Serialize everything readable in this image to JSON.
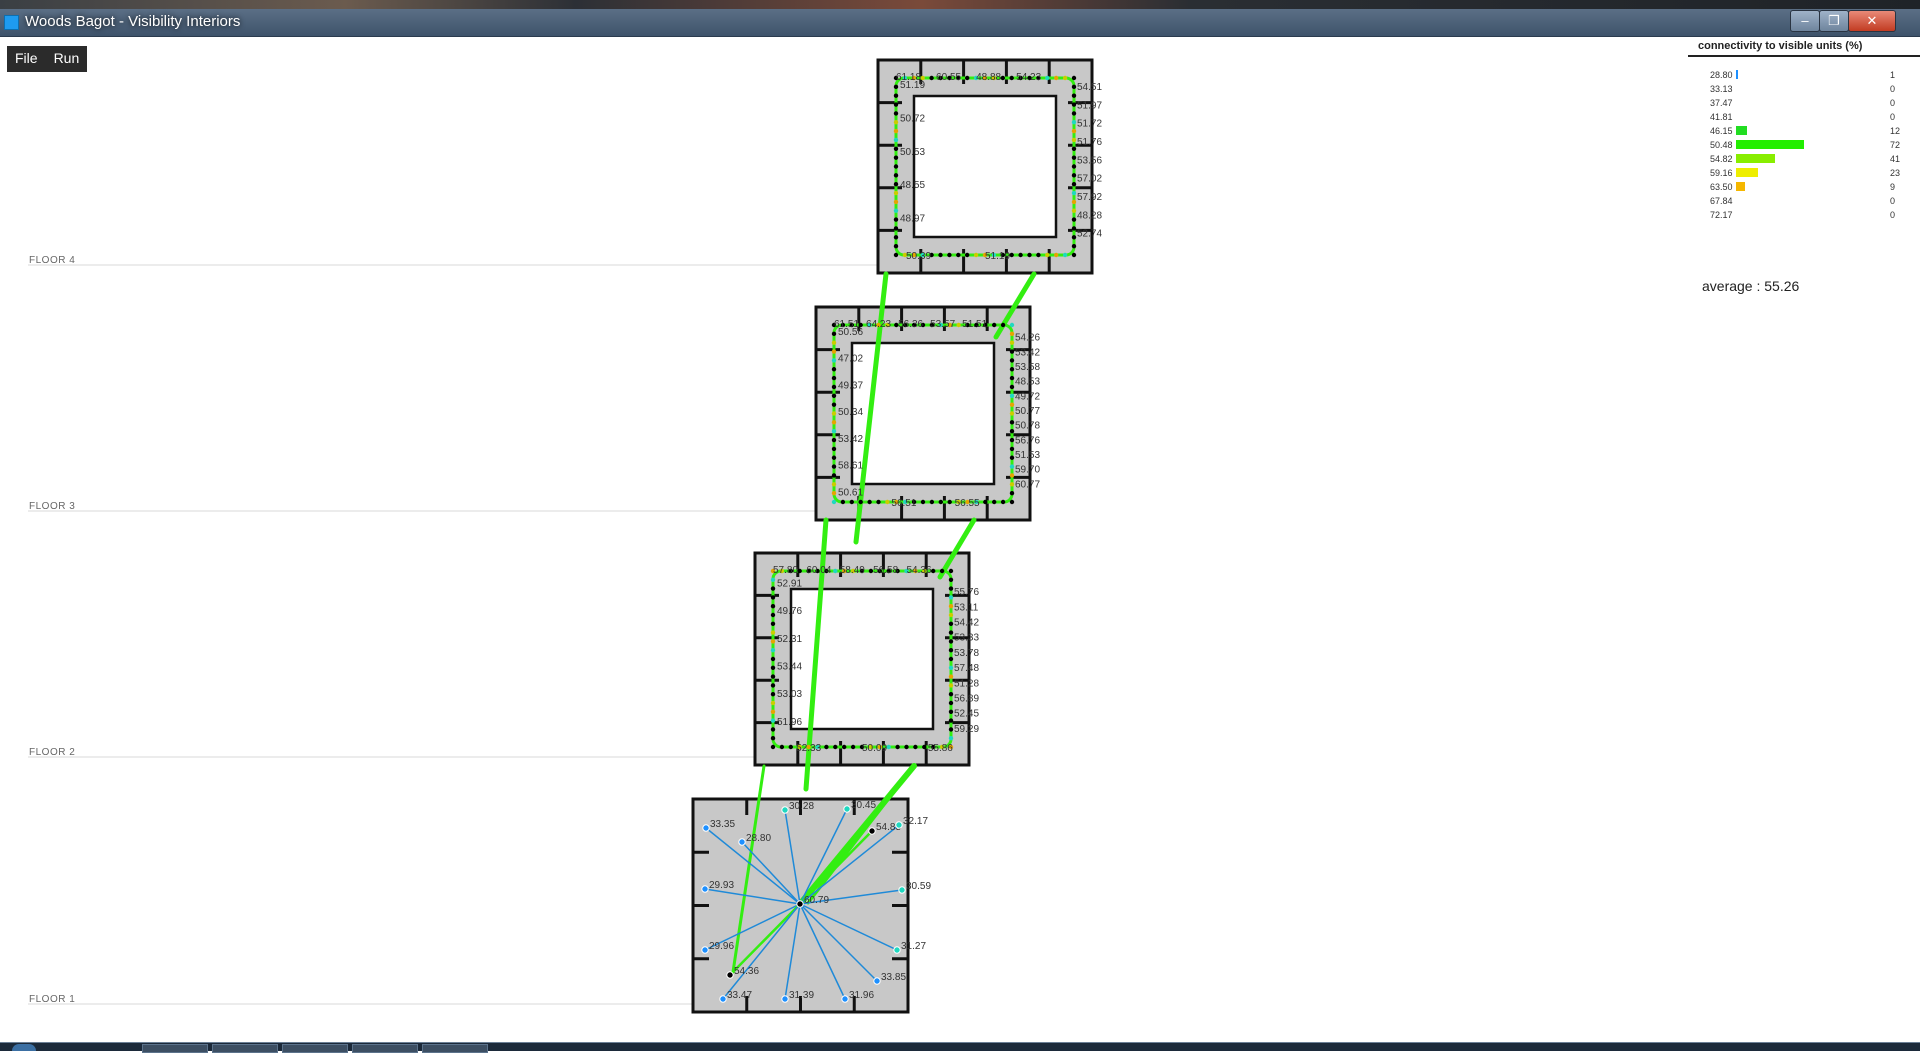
{
  "window": {
    "title": "Woods Bagot - Visibility Interiors",
    "minimize": "–",
    "restore": "❐",
    "close": "✕"
  },
  "menu": {
    "items": [
      "File",
      "Run"
    ]
  },
  "floors": [
    {
      "label": "FLOOR 4"
    },
    {
      "label": "FLOOR 3"
    },
    {
      "label": "FLOOR 2"
    },
    {
      "label": "FLOOR 1"
    }
  ],
  "floor1_points": [
    {
      "label": "33.35",
      "color": "#1e90ff"
    },
    {
      "label": "28.80",
      "color": "#1e90ff"
    },
    {
      "label": "30.28",
      "color": "#20d8c0"
    },
    {
      "label": "30.45",
      "color": "#20d8c0"
    },
    {
      "label": "54.85",
      "color": "#000000"
    },
    {
      "label": "32.17",
      "color": "#20d8c0"
    },
    {
      "label": "29.93",
      "color": "#1e90ff"
    },
    {
      "label": "60.79",
      "color": "#000000"
    },
    {
      "label": "30.59",
      "color": "#20d8c0"
    },
    {
      "label": "29.96",
      "color": "#1e90ff"
    },
    {
      "label": "31.27",
      "color": "#20d8c0"
    },
    {
      "label": "54.36",
      "color": "#000000"
    },
    {
      "label": "33.85",
      "color": "#1e90ff"
    },
    {
      "label": "33.47",
      "color": "#1e90ff"
    },
    {
      "label": "31.39",
      "color": "#1e90ff"
    },
    {
      "label": "31.96",
      "color": "#1e90ff"
    }
  ],
  "ring_labels": {
    "floor4": [
      "61.18",
      "60.55",
      "48.88",
      "54.23",
      "51.19",
      "50.72",
      "50.53",
      "48.55",
      "48.97",
      "50.39",
      "51.19",
      "54.51",
      "51.97",
      "51.72",
      "51.76",
      "53.56",
      "57.02",
      "57.92",
      "48.28",
      "52.74"
    ],
    "floor3": [
      "61.51",
      "64.23",
      "56.36",
      "53.57",
      "51.51",
      "50.56",
      "47.02",
      "49.37",
      "50.34",
      "53.42",
      "58.61",
      "50.61",
      "56.51",
      "56.55",
      "54.26",
      "53.42",
      "53.58",
      "48.53",
      "49.72",
      "50.77",
      "50.78",
      "56.76",
      "51.53",
      "59.70",
      "60.77"
    ],
    "floor2": [
      "57.80",
      "60.04",
      "58.49",
      "56.58",
      "54.36",
      "52.91",
      "49.76",
      "52.31",
      "53.44",
      "53.03",
      "51.96",
      "52.33",
      "50.09",
      "55.86",
      "55.76",
      "53.11",
      "54.42",
      "53.33",
      "53.78",
      "57.48",
      "51.28",
      "56.89",
      "52.45",
      "59.29"
    ]
  },
  "legend": {
    "title": "connectivity to visible units (%)",
    "average": "average : 55.26",
    "bins": [
      {
        "value": "28.80",
        "count": "1",
        "frac": 0.014,
        "color": "#1e90ff"
      },
      {
        "value": "33.13",
        "count": "0",
        "frac": 0,
        "color": "#1e90ff"
      },
      {
        "value": "37.47",
        "count": "0",
        "frac": 0,
        "color": "#20d8c0"
      },
      {
        "value": "41.81",
        "count": "0",
        "frac": 0,
        "color": "#20d8c0"
      },
      {
        "value": "46.15",
        "count": "12",
        "frac": 0.167,
        "color": "#22dd22"
      },
      {
        "value": "50.48",
        "count": "72",
        "frac": 1.0,
        "color": "#22ee00"
      },
      {
        "value": "54.82",
        "count": "41",
        "frac": 0.569,
        "color": "#88ee00"
      },
      {
        "value": "59.16",
        "count": "23",
        "frac": 0.319,
        "color": "#eeee00"
      },
      {
        "value": "63.50",
        "count": "9",
        "frac": 0.125,
        "color": "#f5b700"
      },
      {
        "value": "67.84",
        "count": "0",
        "frac": 0,
        "color": "#f07000"
      },
      {
        "value": "72.17",
        "count": "0",
        "frac": 0,
        "color": "#e02000"
      }
    ]
  }
}
